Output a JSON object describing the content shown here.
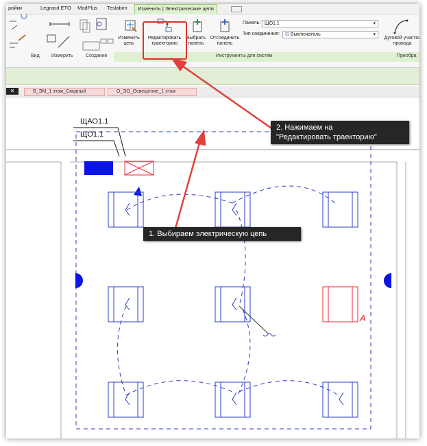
{
  "ribbon": {
    "tabs": [
      "ройки",
      "Legrand ETO",
      "ModPlus",
      "Teslabim",
      "Изменить | Электрические цепи"
    ],
    "buttons": {
      "edit_circuit": "Изменить\nцепь",
      "edit_path": "Редактировать\nтраекторию",
      "select_panel": "Выбрать\nпанель",
      "disconnect_panel": "Отсоединить\nпанель",
      "arc_wire": "Дуговой участок\nпровода"
    },
    "groups": [
      "Вид",
      "Измерить",
      "Создание",
      "Инструменты для систем",
      "Преобра"
    ],
    "panel_label": "Панель:",
    "panel_value": "ЩО1.1",
    "connection_label": "Тип соединения:",
    "connection_value": "Выключатель"
  },
  "view_tabs": [
    "В_ЭМ_1 этаж_Сводный",
    "О_ЭО_Освещение_1 этаж"
  ],
  "drawing": {
    "tag1": "ЩАО1.1",
    "tag2": "ЩО1.1",
    "fixture_mark": "А"
  },
  "callouts": {
    "step1": "1. Выбираем электрическую цепь",
    "step2_line1": "2. Нажимаем на",
    "step2_line2": "\"Редактировать траекторию\""
  },
  "colors": {
    "highlight": "#d9342b",
    "arrow": "#e0413b",
    "wiring": "#2a3cc7",
    "selected": "#ee2a35",
    "panel_fill": "#0a14e6"
  }
}
